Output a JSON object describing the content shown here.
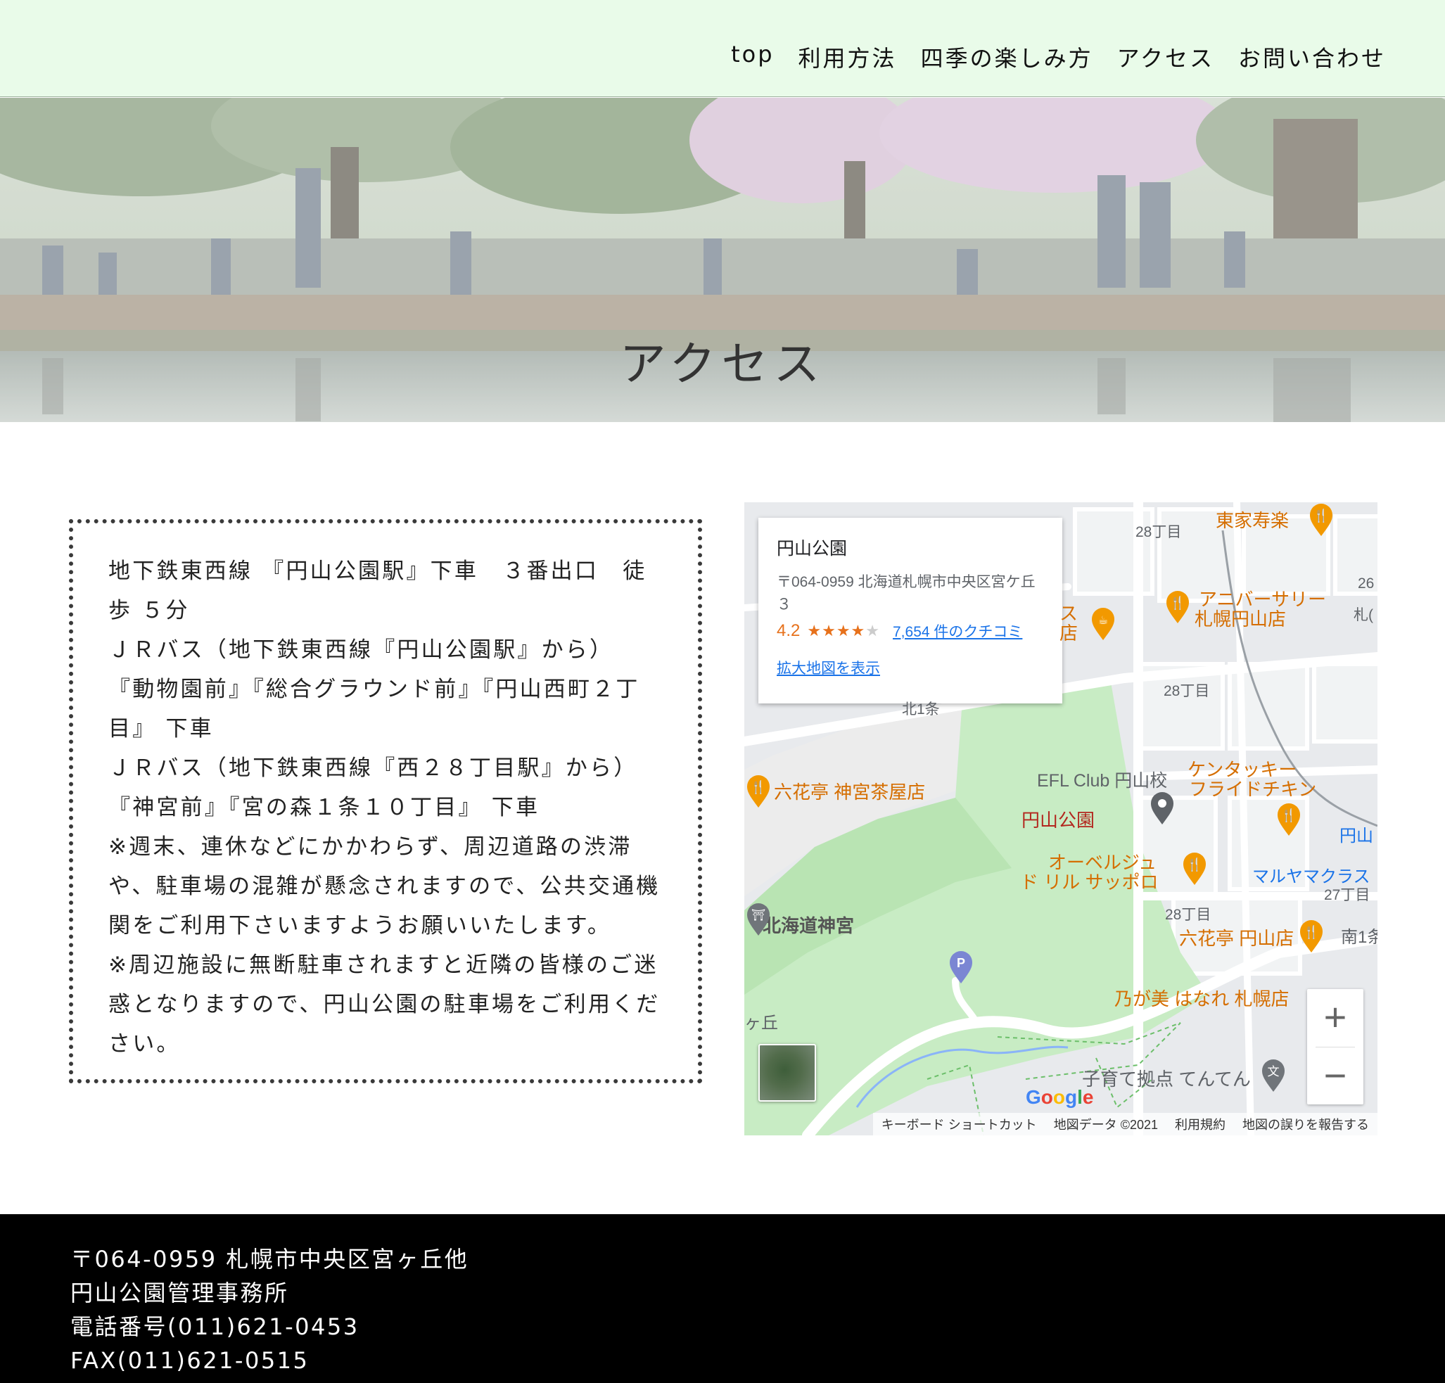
{
  "nav": {
    "items": [
      {
        "label": "top"
      },
      {
        "label": "利用方法"
      },
      {
        "label": "四季の楽しみ方"
      },
      {
        "label": "アクセス"
      },
      {
        "label": "お問い合わせ"
      }
    ]
  },
  "hero": {
    "title": "アクセス"
  },
  "access": {
    "lines": [
      "地下鉄東西線 『円山公園駅』下車　３番出口　徒歩 ５分",
      "ＪＲバス（地下鉄東西線『円山公園駅』から）",
      "『動物園前』『総合グラウンド前』『円山西町２丁目』 下車",
      "ＪＲバス（地下鉄東西線『西２８丁目駅』から）",
      "『神宮前』『宮の森１条１０丁目』 下車",
      "※週末、連休などにかかわらず、周辺道路の渋滞や、駐車場の混雑が懸念されますので、公共交通機関をご利用下さいますようお願いいたします。",
      "※周辺施設に無断駐車されますと近隣の皆様のご迷惑となりますので、円山公園の駐車場をご利用ください。"
    ]
  },
  "map": {
    "card": {
      "place_name": "円山公園",
      "address": "〒064-0959 北海道札幌市中央区宮ケ丘３",
      "rating": "4.2",
      "stars_filled": "★★★★",
      "stars_empty": "★",
      "reviews": "7,654 件のクチコミ",
      "larger_map": "拡大地図を表示"
    },
    "labels": {
      "tokaju": "東家寿楽",
      "anniversary_1": "アニバーサリー",
      "anniversary_2": "札幌円山店",
      "chome28_a": "28丁目",
      "chome28_b": "28丁目",
      "chome28_c": "28丁目",
      "chome27": "27丁目",
      "num26": "26",
      "satsu": "札(",
      "rokkatei_jingu": "六花亭 神宮茶屋店",
      "efl": "EFL Club 円山校",
      "kfc_1": "ケンタッキー",
      "kfc_2": "フライドチキン",
      "maruyama_park": "円山公園",
      "auberge_1": "オーベルジュ",
      "auberge_2": "ド リル サッポロ",
      "maruyama_club": "マルヤマクラス",
      "maruyama_blue": "円山",
      "hokkaido_jingu": "北海道神宮",
      "rokkatei_maruyama": "六花亭 円山店",
      "minami1": "南1条",
      "nogami": "乃が美 はなれ 札幌店",
      "kosodate": "子育て拠点 てんてん",
      "ka_oka": "ヶ丘",
      "kita1": "北1条",
      "su": "ス",
      "ten": "店"
    },
    "google": "Google",
    "footer": {
      "shortcuts": "キーボード ショートカット",
      "data": "地図データ ©2021",
      "terms": "利用規約",
      "report": "地図の誤りを報告する"
    },
    "zoom_in": "+",
    "zoom_out": "−",
    "pin_p": "P",
    "pin_school": "文"
  },
  "footer": {
    "address": "〒064-0959 札幌市中央区宮ヶ丘他",
    "office": "円山公園管理事務所",
    "phone": "電話番号(011)621-0453",
    "fax": "FAX(011)621-0515"
  },
  "colors": {
    "header_bg": "#e9fbe9",
    "footer_bg": "#000000",
    "map_accent_orange": "#d56e00",
    "map_link_blue": "#1a73e8",
    "map_park_green": "#c8ecc4"
  }
}
